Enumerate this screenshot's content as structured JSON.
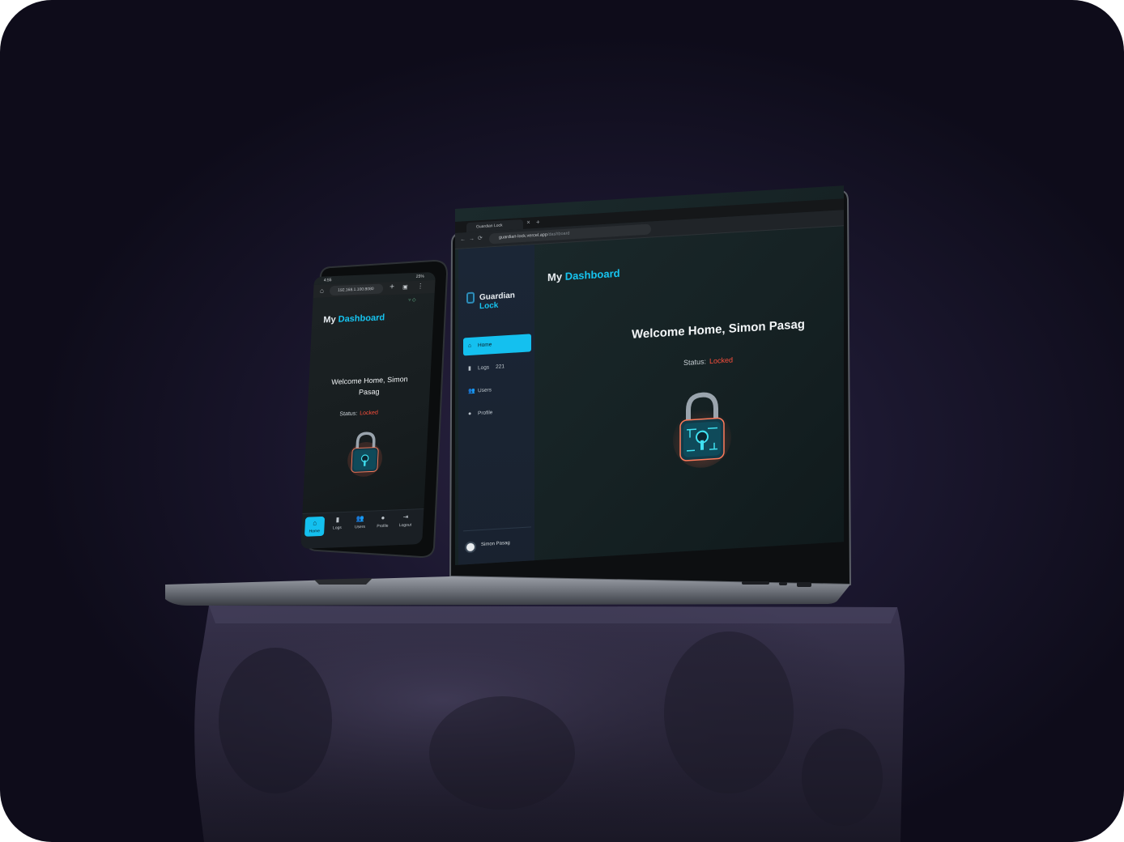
{
  "app": {
    "brand_prefix": "Guardian",
    "brand_accent": "Lock",
    "accent_color": "#16c4f0",
    "locked_color": "#ff4f3c"
  },
  "laptop": {
    "tab_label": "Guardian Lock",
    "url_host": "guardian-lock.vercel.app",
    "url_path": "/dashboard",
    "title_prefix": "My",
    "title_accent": "Dashboard",
    "welcome": "Welcome Home, Simon Pasag",
    "status_label": "Status:",
    "status_value": "Locked",
    "nav": [
      {
        "label": "Home",
        "icon": "home-icon",
        "active": true
      },
      {
        "label": "Logs",
        "icon": "clipboard-icon",
        "badge": "221"
      },
      {
        "label": "Users",
        "icon": "users-icon"
      },
      {
        "label": "Profile",
        "icon": "user-icon"
      }
    ],
    "user_name": "Simon Pasag"
  },
  "phone": {
    "time": "4:55",
    "battery": "25%",
    "url": "192.168.1.100:8080",
    "title_prefix": "My",
    "title_accent": "Dashboard",
    "welcome": "Welcome Home, Simon Pasag",
    "status_label": "Status:",
    "status_value": "Locked",
    "nav": [
      {
        "label": "Home",
        "icon": "home-icon",
        "active": true
      },
      {
        "label": "Logs",
        "icon": "clipboard-icon"
      },
      {
        "label": "Users",
        "icon": "users-icon"
      },
      {
        "label": "Profile",
        "icon": "user-icon"
      },
      {
        "label": "Logout",
        "icon": "logout-icon"
      }
    ]
  }
}
